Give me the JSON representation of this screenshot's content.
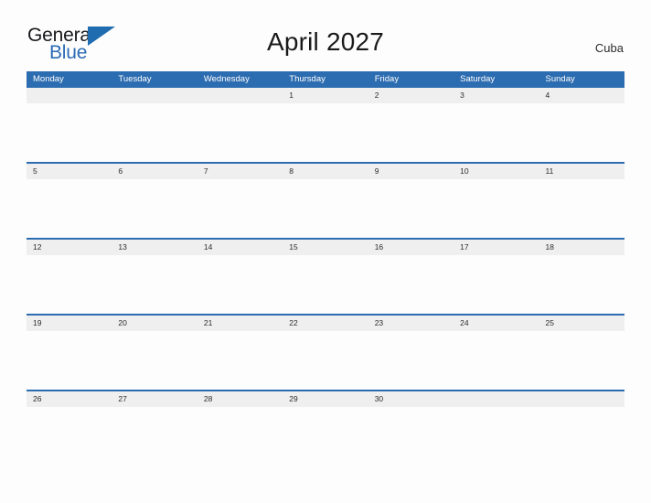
{
  "branding": {
    "logo_primary": "General",
    "logo_secondary": "Blue",
    "logo_triangle_icon": "triangle-icon",
    "accent_color": "#2c6cb0",
    "header_text_color": "#ffffff",
    "date_band_color": "#efefef"
  },
  "header": {
    "title": "April 2027",
    "country": "Cuba"
  },
  "calendar": {
    "weekdays": [
      "Monday",
      "Tuesday",
      "Wednesday",
      "Thursday",
      "Friday",
      "Saturday",
      "Sunday"
    ],
    "weeks": [
      [
        "",
        "",
        "",
        "1",
        "2",
        "3",
        "4"
      ],
      [
        "5",
        "6",
        "7",
        "8",
        "9",
        "10",
        "11"
      ],
      [
        "12",
        "13",
        "14",
        "15",
        "16",
        "17",
        "18"
      ],
      [
        "19",
        "20",
        "21",
        "22",
        "23",
        "24",
        "25"
      ],
      [
        "26",
        "27",
        "28",
        "29",
        "30",
        "",
        ""
      ]
    ]
  }
}
